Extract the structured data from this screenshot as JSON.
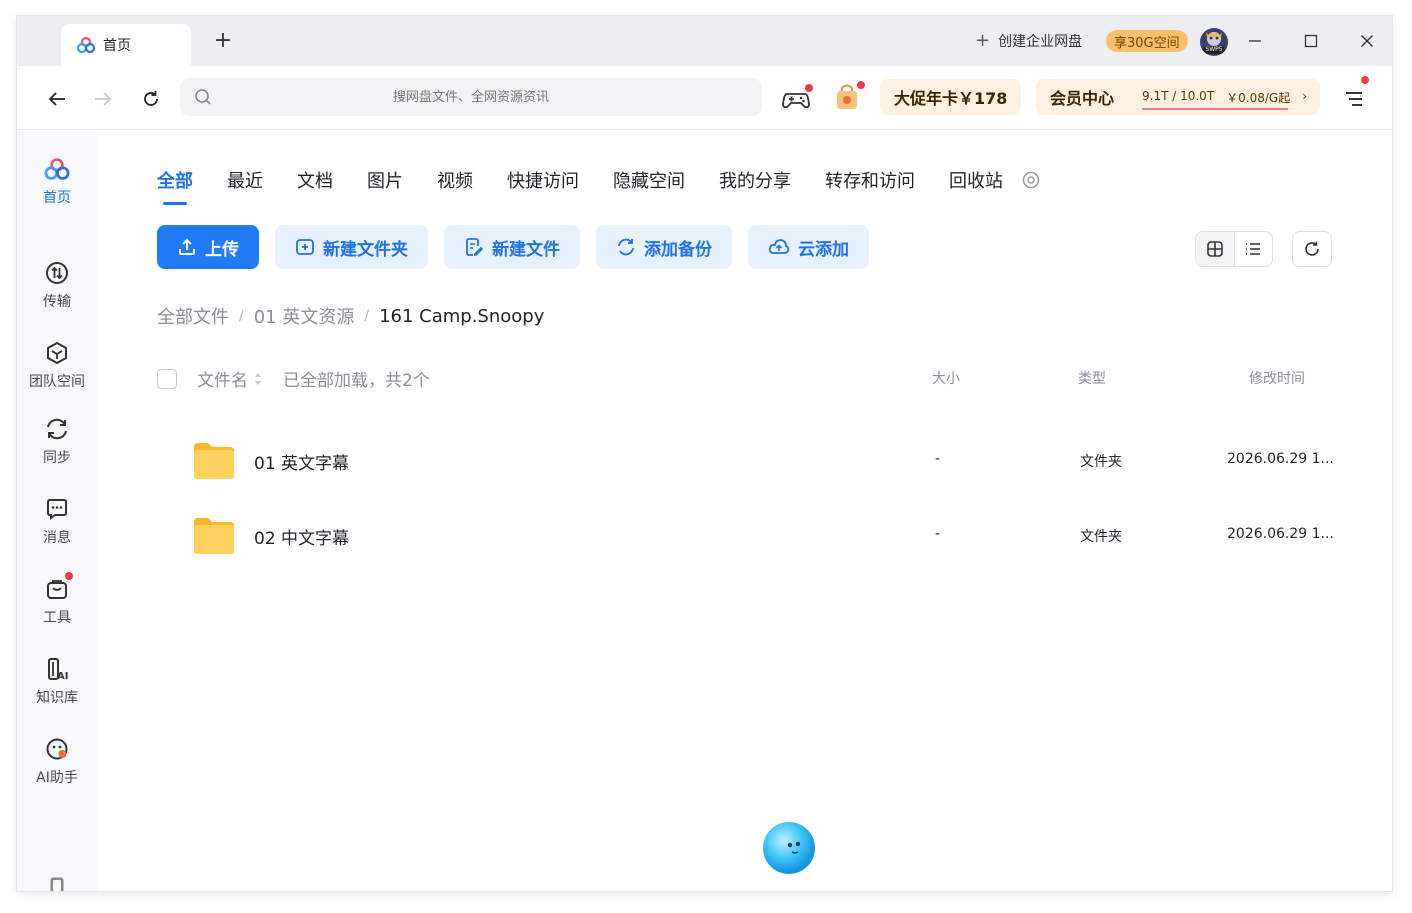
{
  "titlebar": {
    "tab_label": "首页",
    "new_tab": "+",
    "enterprise_label": "创建企业网盘",
    "enterprise_badge": "享30G空间",
    "avatar_tag": "SWP5",
    "minimize": "—",
    "maximize": "☐",
    "close": "✕"
  },
  "navbar": {
    "search_placeholder": "搜网盘文件、全网资源资讯",
    "promo_label": "大促年卡￥178",
    "vip": {
      "title": "会员中心",
      "storage": "9.1T / 10.0T",
      "price": "￥0.08/G起",
      "chevron": "›"
    }
  },
  "sidebar": {
    "items": [
      {
        "label": "首页",
        "icon": "home-logo-icon"
      },
      {
        "label": "传输",
        "icon": "transfer-icon"
      },
      {
        "label": "团队空间",
        "icon": "team-space-icon"
      },
      {
        "label": "同步",
        "icon": "sync-icon"
      },
      {
        "label": "消息",
        "icon": "message-icon"
      },
      {
        "label": "工具",
        "icon": "tools-icon"
      },
      {
        "label": "知识库",
        "icon": "knowledge-base-icon"
      },
      {
        "label": "AI助手",
        "icon": "ai-assistant-icon"
      }
    ]
  },
  "main": {
    "tabs": [
      "全部",
      "最近",
      "文档",
      "图片",
      "视频",
      "快捷访问",
      "隐藏空间",
      "我的分享",
      "转存和访问",
      "回收站"
    ],
    "actions": {
      "upload": "上传",
      "new_folder": "新建文件夹",
      "new_file": "新建文件",
      "add_backup": "添加备份",
      "cloud_add": "云添加"
    },
    "breadcrumb": {
      "root": "全部文件",
      "level1": "01 英文资源",
      "current": "161 Camp.Snoopy",
      "separator": "/"
    },
    "list_header": {
      "name": "文件名",
      "loaded": "已全部加载，共2个",
      "size": "大小",
      "type": "类型",
      "modified": "修改时间"
    },
    "rows": [
      {
        "name": "01 英文字幕",
        "size": "-",
        "type": "文件夹",
        "modified": "2026.06.29 1..."
      },
      {
        "name": "02 中文字幕",
        "size": "-",
        "type": "文件夹",
        "modified": "2026.06.29 1..."
      }
    ]
  },
  "colors": {
    "accent": "#1f72e8",
    "primary_button": "#1f7cf6",
    "secondary_button_bg": "#e8f1fe",
    "folder": "#fcc744",
    "promo_bg": "#fdf1e1",
    "notification_dot": "#f5364d"
  }
}
